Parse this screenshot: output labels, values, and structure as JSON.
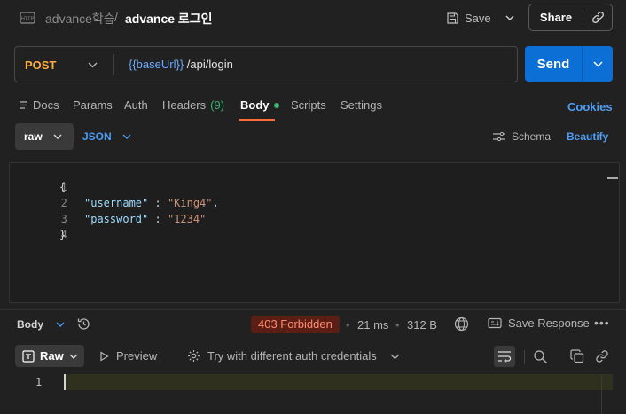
{
  "header": {
    "breadcrumb_parent": "advance학습",
    "breadcrumb_sep": "/",
    "breadcrumb_current": "advance 로그인",
    "save_label": "Save",
    "share_label": "Share"
  },
  "request": {
    "method": "POST",
    "url_var": "{{baseUrl}}",
    "url_path": " /api/login",
    "send_label": "Send"
  },
  "tabs": [
    {
      "label": "Docs"
    },
    {
      "label": "Params"
    },
    {
      "label": "Auth"
    },
    {
      "label": "Headers",
      "count": "(9)"
    },
    {
      "label": "Body",
      "active": true
    },
    {
      "label": "Scripts"
    },
    {
      "label": "Settings"
    }
  ],
  "cookies_label": "Cookies",
  "body_toolbar": {
    "mode": "raw",
    "language": "JSON",
    "schema_label": "Schema",
    "beautify_label": "Beautify"
  },
  "editor": {
    "lines": [
      {
        "n": "1",
        "text": "{"
      },
      {
        "n": "2",
        "key": "\"username\"",
        "sep": " : ",
        "val": "\"King4\"",
        "end": ","
      },
      {
        "n": "3",
        "key": "\"password\"",
        "sep": " : ",
        "val": "\"1234\"",
        "end": ""
      },
      {
        "n": "4",
        "text": "}"
      }
    ]
  },
  "response": {
    "section_label": "Body",
    "status": "403 Forbidden",
    "time": "21 ms",
    "size": "312 B",
    "save_response_label": "Save Response",
    "view_mode": "Raw",
    "preview_label": "Preview",
    "try_auth_label": "Try with different auth credentials",
    "line_number": "1"
  },
  "colors": {
    "accent_send": "#0c6fd6",
    "method_post": "#ffad42",
    "status_error": "#ff8a6e",
    "link_blue": "#4c9df5",
    "tab_underline": "#ff6c37"
  }
}
